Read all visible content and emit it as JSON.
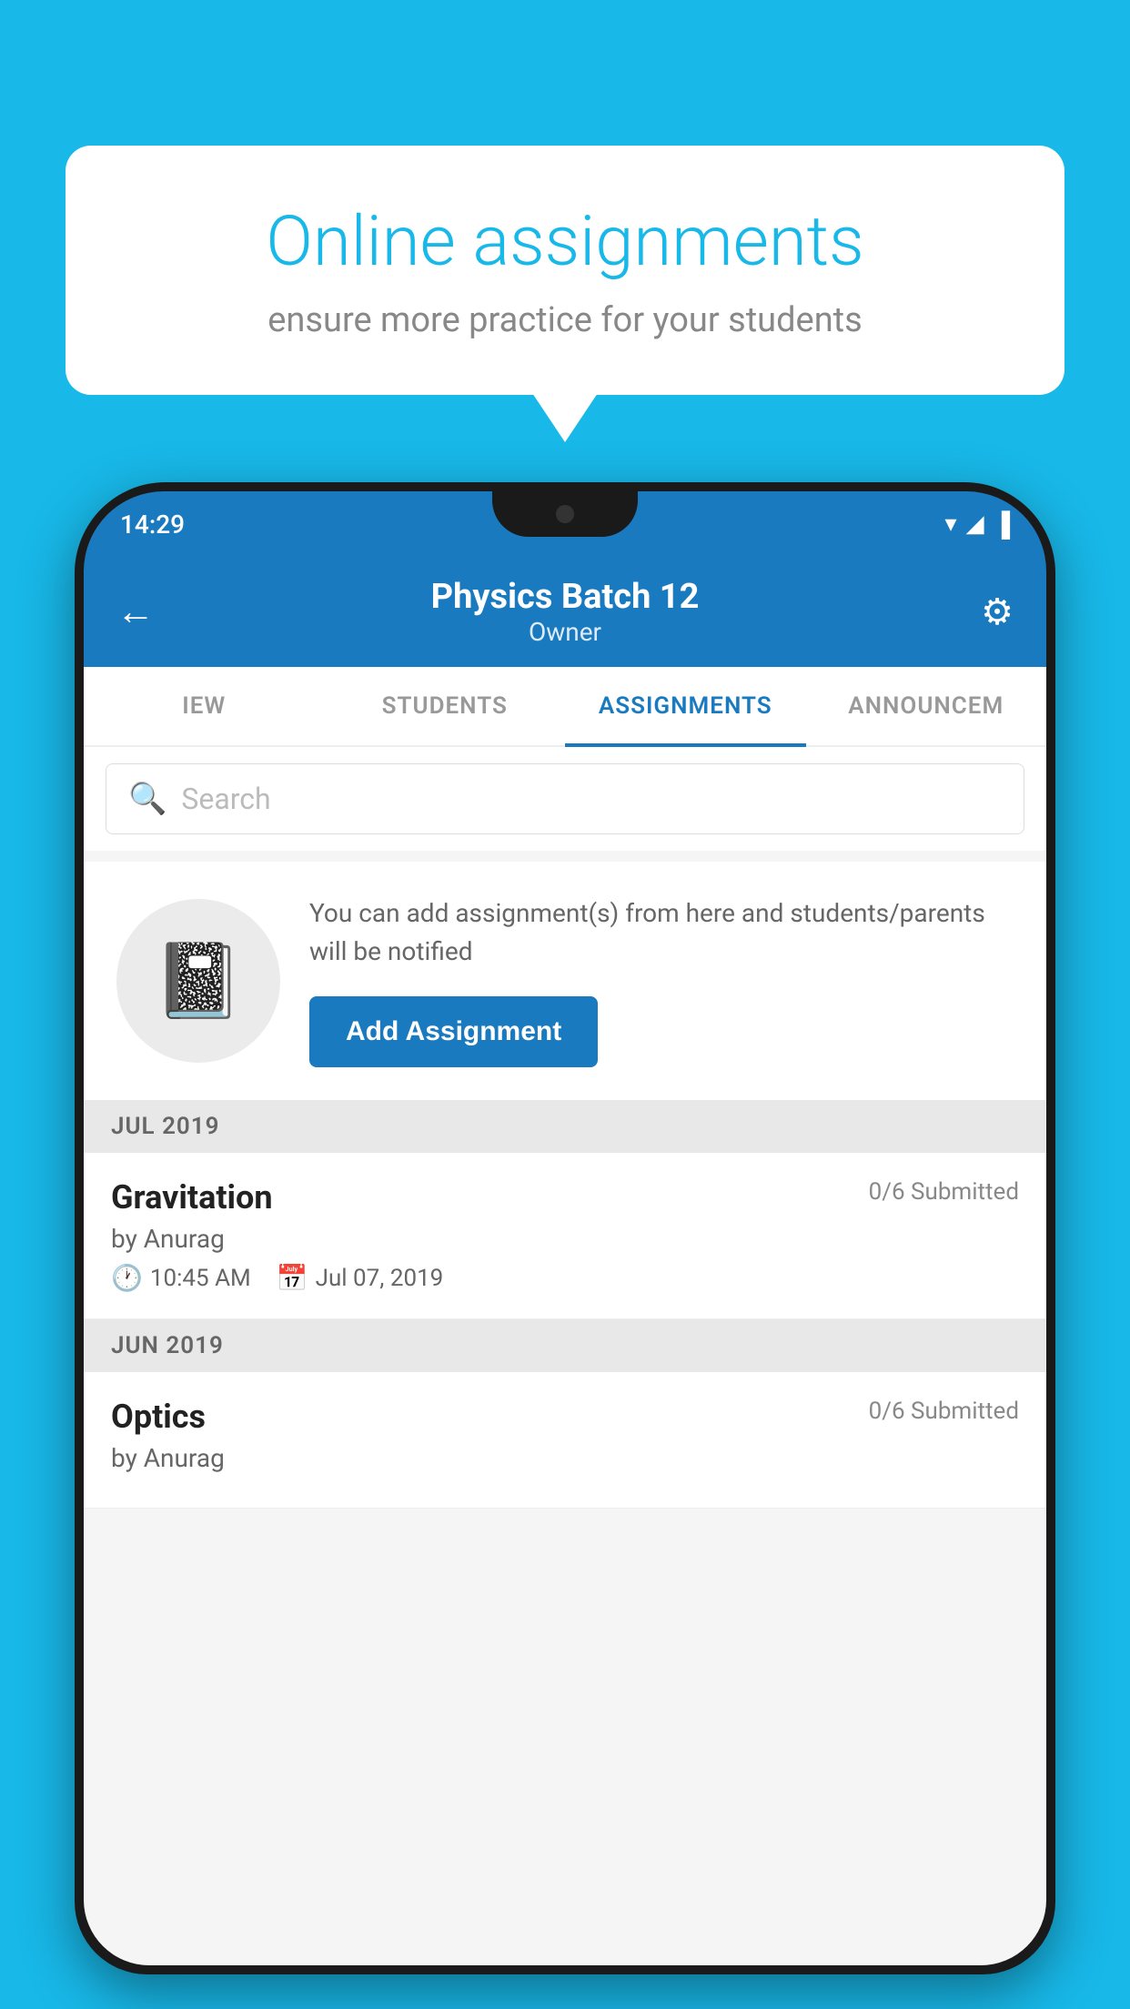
{
  "background_color": "#18B8E8",
  "speech_bubble": {
    "title": "Online assignments",
    "subtitle": "ensure more practice for your students"
  },
  "phone": {
    "status_bar": {
      "time": "14:29",
      "icons": [
        "▼",
        "◀",
        "▐"
      ]
    },
    "header": {
      "title": "Physics Batch 12",
      "subtitle": "Owner",
      "back_label": "←",
      "settings_label": "⚙"
    },
    "tabs": [
      {
        "label": "IEW",
        "active": false
      },
      {
        "label": "STUDENTS",
        "active": false
      },
      {
        "label": "ASSIGNMENTS",
        "active": true
      },
      {
        "label": "ANNOUNCEM",
        "active": false
      }
    ],
    "search": {
      "placeholder": "Search"
    },
    "promo": {
      "text": "You can add assignment(s) from here and students/parents will be notified",
      "button_label": "Add Assignment"
    },
    "sections": [
      {
        "month": "JUL 2019",
        "assignments": [
          {
            "name": "Gravitation",
            "submitted": "0/6 Submitted",
            "by": "by Anurag",
            "time": "10:45 AM",
            "date": "Jul 07, 2019"
          }
        ]
      },
      {
        "month": "JUN 2019",
        "assignments": [
          {
            "name": "Optics",
            "submitted": "0/6 Submitted",
            "by": "by Anurag",
            "time": "",
            "date": ""
          }
        ]
      }
    ]
  }
}
